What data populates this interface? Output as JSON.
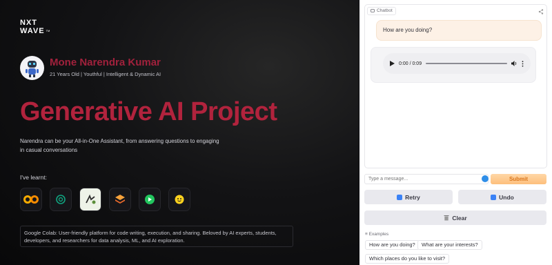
{
  "brand": {
    "line1": "NXT",
    "line2": "WAVE",
    "tm": "TM"
  },
  "profile": {
    "name": "Mone Narendra Kumar",
    "tagline": "21 Years Old | Youthful | Intelligent & Dynamic AI"
  },
  "hero": {
    "headline": "Generative AI Project",
    "description": "Narendra can be your All-in-One Assistant, from answering questions to engaging in casual conversations",
    "learnt_label": "I've learnt:",
    "tools": [
      "colab-icon",
      "openai-icon",
      "langchain-icon",
      "layers-icon",
      "play-icon",
      "huggingface-icon"
    ],
    "info": "Google Colab: User-friendly platform for code writing, execution, and sharing. Beloved by AI experts, students, developers, and researchers for data analysis, ML, and AI exploration."
  },
  "chat": {
    "label": "Chatbot",
    "user_message": "How are you doing?",
    "audio": {
      "time": "0:00 / 0:09",
      "progress": 0
    }
  },
  "composer": {
    "placeholder": "Type a message...",
    "submit": "Submit"
  },
  "actions": {
    "retry": "Retry",
    "undo": "Undo",
    "clear": "Clear"
  },
  "examples": {
    "title": "Examples",
    "items": [
      "How are you doing?",
      "What are your interests?",
      "Which places do you like to visit?"
    ]
  },
  "colors": {
    "accent_red": "#b1233d",
    "submit_orange": "#fdbf7c"
  }
}
